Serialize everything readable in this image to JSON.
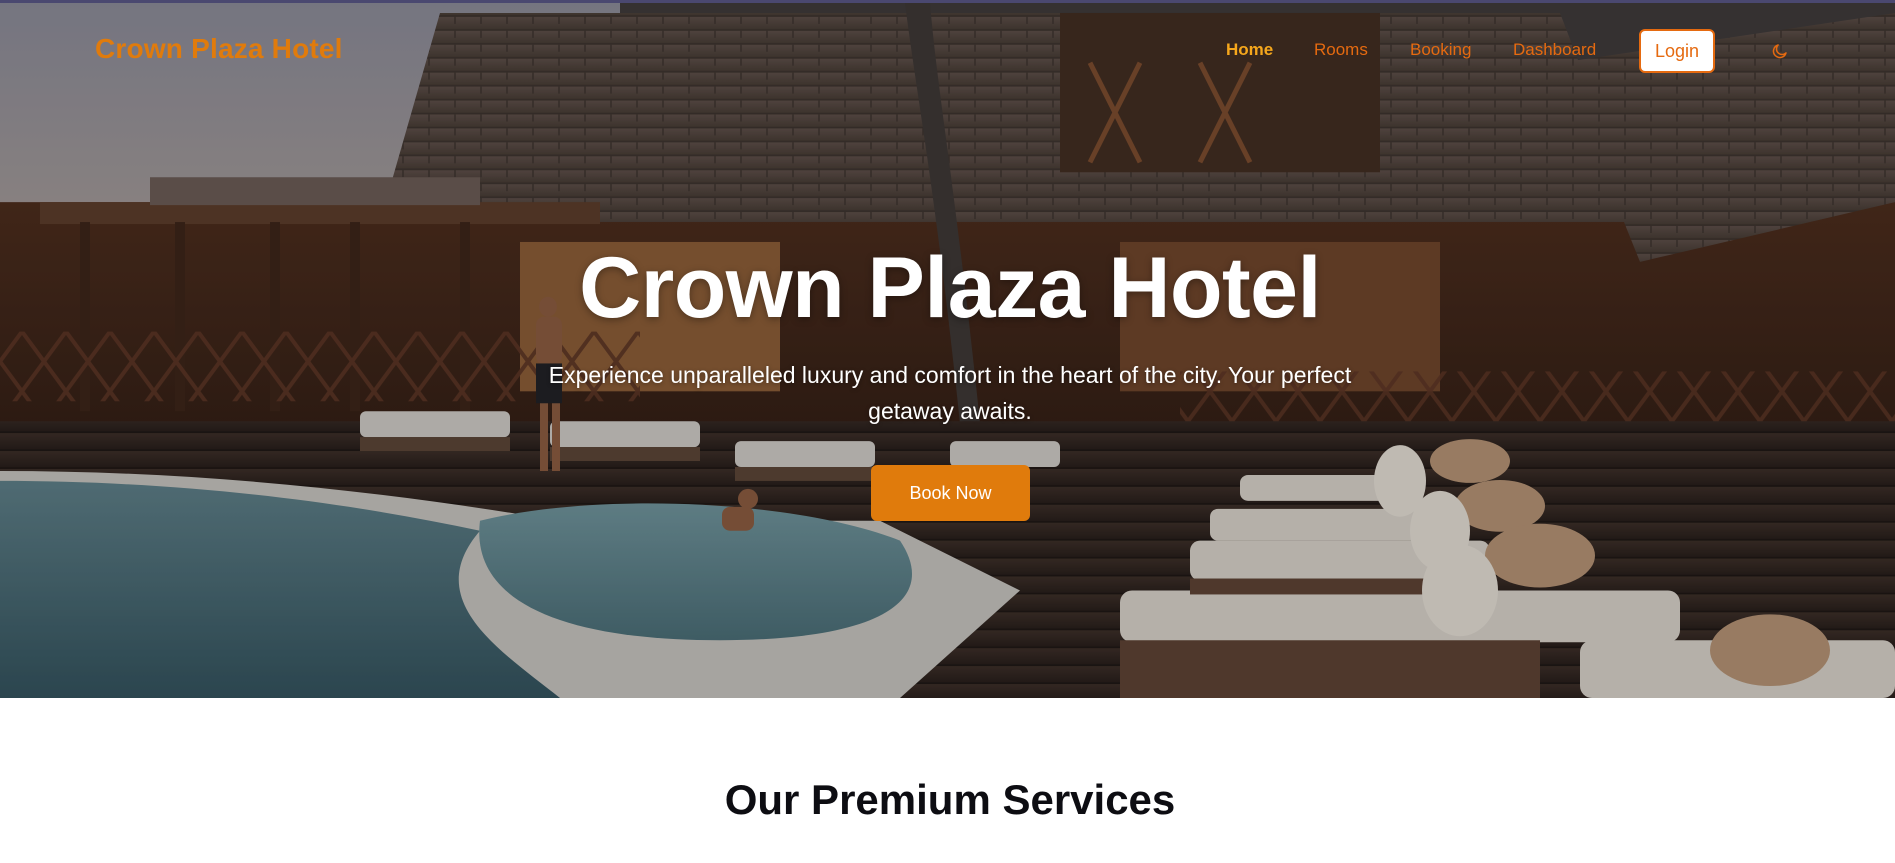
{
  "navbar": {
    "brand": "Crown Plaza Hotel",
    "links": [
      {
        "label": "Home",
        "active": true
      },
      {
        "label": "Rooms",
        "active": false
      },
      {
        "label": "Booking",
        "active": false
      },
      {
        "label": "Dashboard",
        "active": false
      }
    ],
    "login_label": "Login",
    "theme_toggle_icon": "moon-icon"
  },
  "hero": {
    "title": "Crown Plaza Hotel",
    "subtitle": "Experience unparalleled luxury and comfort in the heart of the city. Your perfect getaway awaits.",
    "cta_label": "Book Now"
  },
  "services": {
    "heading": "Our Premium Services"
  },
  "colors": {
    "accent": "#e07b0c",
    "link": "#e56a10",
    "active_link": "#f5a71c"
  }
}
